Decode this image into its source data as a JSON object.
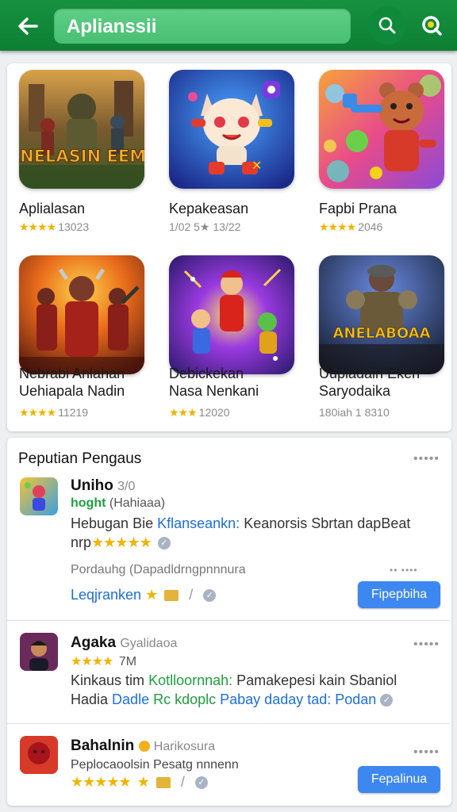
{
  "appbar": {
    "search_value": "Aplianssii"
  },
  "games": [
    {
      "name": "Aplialasan",
      "stars": "★★★★",
      "rating": "13023",
      "art_text": "HANELASIN EEMAE"
    },
    {
      "name": "Kepakeasan",
      "stars": "",
      "rating": "1/02 5★ 13/22",
      "art_text": ""
    },
    {
      "name": "Fapbi Prana",
      "stars": "★★★★",
      "rating": "2046",
      "art_text": ""
    },
    {
      "name": "Nebrabi Anlahan",
      "name2": "Uehiapala Nadin",
      "stars": "★★★★",
      "rating": "11219",
      "art_text": ""
    },
    {
      "name": "Debickekan",
      "name2": "Nasa Nenkani",
      "stars": "★★★",
      "rating": "12020",
      "art_text": ""
    },
    {
      "name": "Uupiadain Eken",
      "name2": "Saryodaika",
      "stars": "",
      "rating": "180iah 1 8310",
      "art_text": "ANELABOAA"
    }
  ],
  "section": {
    "title": "Peputian Pengaus",
    "more": "•••••",
    "items": [
      {
        "title": "Uniho",
        "title_suffix": "3/0",
        "tag": "hoght",
        "tag_note": "(Hahiaaa)",
        "line1_a": "Hebugan Bie",
        "line1_b": "Kflanseankn:",
        "line1_c": "Keanorsis Sbrtan dapBeat",
        "line2_a": "nrp",
        "stars": "★★★★★",
        "line3": "Pordauhg (Dapadldrngpnnnura",
        "link": "Leqjranken",
        "button": "Fipepbiha",
        "more": "•• ••••"
      },
      {
        "title": "Agaka",
        "title_suffix": "Gyalidaoa",
        "stars": "★★★★",
        "count": "7M",
        "line1_a": "Kinkaus tim",
        "line1_b": "Kotlloornnah:",
        "line1_c": "Pamakepesi kain Sbaniol",
        "line2_a": "Hadia",
        "line2_b": "Dadle",
        "line2_c": "Rc kdoplc",
        "line2_d": "Pabay daday tad: Podan",
        "more": "•••••"
      },
      {
        "title": "Bahalnin",
        "title_suffix": "Harikosura",
        "line1": "Peplocaoolsin Pesatg nnnenn",
        "stars": "★★★★★",
        "button": "Fepalinua",
        "more": "•••••"
      }
    ]
  }
}
